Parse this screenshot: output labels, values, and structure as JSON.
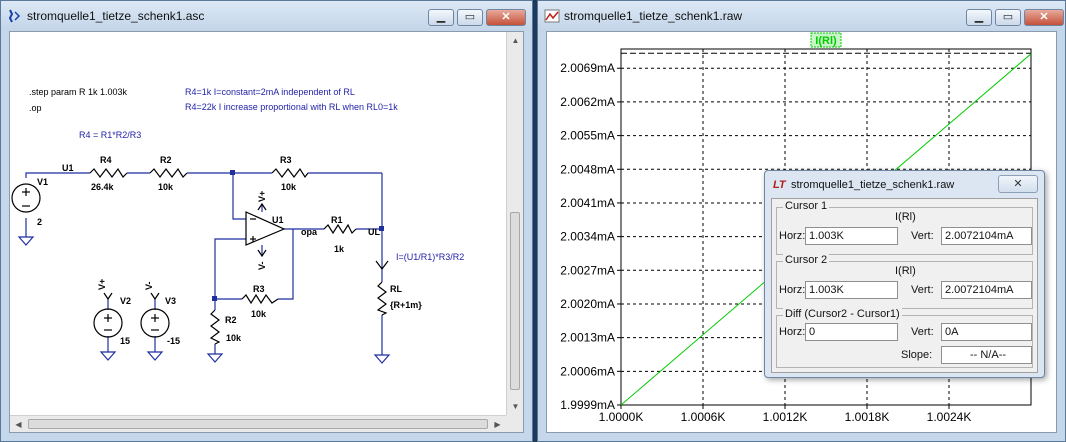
{
  "schematic_window": {
    "title": "stromquelle1_tietze_schenk1.asc",
    "buttons": {
      "minimize": "▁",
      "maximize": "▭",
      "close": "✕"
    },
    "directives": {
      "step": ".step param R 1k 1.003k",
      "op": ".op"
    },
    "comments": {
      "line1": "R4=1k I=constant=2mA independent of RL",
      "line2": "R4=22k I increase proportional with RL when RL0=1k",
      "formula": "R4 = R1*R2/R3",
      "current": "I=(U1/R1)*R3/R2"
    },
    "components": {
      "V1": {
        "name": "V1",
        "value": "2"
      },
      "R4": {
        "name": "R4",
        "value": "26.4k"
      },
      "R2a": {
        "name": "R2",
        "value": "10k"
      },
      "R3a": {
        "name": "R3",
        "value": "10k"
      },
      "U1": {
        "name": "U1"
      },
      "R1": {
        "name": "R1",
        "value": "1k"
      },
      "RL": {
        "name": "RL",
        "value": "{R+1m}"
      },
      "R3b": {
        "name": "R3",
        "value": "10k"
      },
      "R2b": {
        "name": "R2",
        "value": "10k"
      },
      "V2": {
        "name": "V2",
        "value": "15"
      },
      "V3": {
        "name": "V3",
        "value": "-15"
      }
    },
    "net_labels": {
      "u1": "U1",
      "opa": "opa",
      "ul": "UL",
      "vplus": "V+",
      "vminus": "V-"
    }
  },
  "plot_window": {
    "title": "stromquelle1_tietze_schenk1.raw",
    "buttons": {
      "minimize": "▁",
      "maximize": "▭",
      "close": "✕"
    }
  },
  "chart_data": {
    "type": "line",
    "series": [
      {
        "name": "I(Rl)",
        "color": "#00cc00",
        "x": [
          1.0,
          1.003
        ],
        "y": [
          1.9999,
          2.0072
        ]
      }
    ],
    "xlabel": "",
    "ylabel": "",
    "x_ticks": [
      "1.0000K",
      "1.0006K",
      "1.0012K",
      "1.0018K",
      "1.0024K"
    ],
    "x_tick_values": [
      1.0,
      1.0006,
      1.0012,
      1.0018,
      1.0024
    ],
    "y_ticks": [
      "1.9999mA",
      "2.0006mA",
      "2.0013mA",
      "2.0020mA",
      "2.0027mA",
      "2.0034mA",
      "2.0041mA",
      "2.0048mA",
      "2.0055mA",
      "2.0062mA",
      "2.0069mA"
    ],
    "y_tick_values": [
      1.9999,
      2.0006,
      2.0013,
      2.002,
      2.0027,
      2.0034,
      2.0041,
      2.0048,
      2.0055,
      2.0062,
      2.0069
    ],
    "xlim": [
      1.0,
      1.003
    ],
    "ylim": [
      1.9999,
      2.0073
    ],
    "grid": true,
    "cursor_y": 2.0072104
  },
  "cursor_dialog": {
    "title": "stromquelle1_tietze_schenk1.raw",
    "close": "✕",
    "cursor1": {
      "label": "Cursor 1",
      "trace": "I(Rl)",
      "horz_label": "Horz:",
      "horz": "1.003K",
      "vert_label": "Vert:",
      "vert": "2.0072104mA"
    },
    "cursor2": {
      "label": "Cursor 2",
      "trace": "I(Rl)",
      "horz_label": "Horz:",
      "horz": "1.003K",
      "vert_label": "Vert:",
      "vert": "2.0072104mA"
    },
    "diff": {
      "label": "Diff (Cursor2 - Cursor1)",
      "horz_label": "Horz:",
      "horz": "0",
      "vert_label": "Vert:",
      "vert": "0A",
      "slope_label": "Slope:",
      "slope": "-- N/A--"
    }
  }
}
